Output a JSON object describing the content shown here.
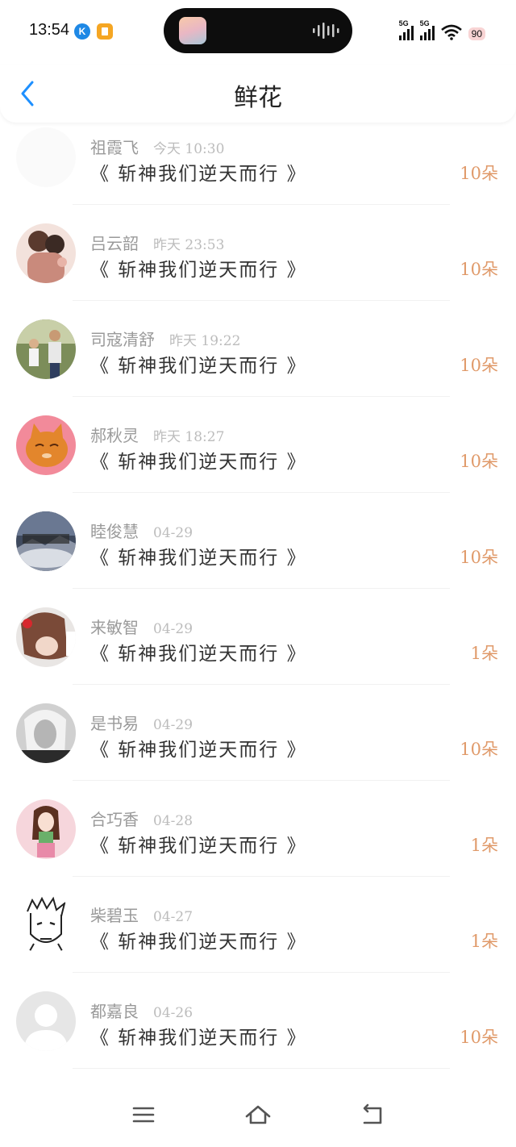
{
  "status_bar": {
    "time": "13:54",
    "badge_k": "K",
    "net1": "5G",
    "net2": "5G",
    "battery": "90"
  },
  "nav": {
    "title": "鲜花"
  },
  "items": [
    {
      "name": "祖霞飞",
      "date": "今天 10:30",
      "book": "《 斩神我们逆天而行 》",
      "count": "10朵",
      "avatar": "faded-blank"
    },
    {
      "name": "吕云韶",
      "date": "昨天 23:53",
      "book": "《 斩神我们逆天而行 》",
      "count": "10朵",
      "avatar": "anime-couple"
    },
    {
      "name": "司寇清舒",
      "date": "昨天 19:22",
      "book": "《 斩神我们逆天而行 》",
      "count": "10朵",
      "avatar": "outdoor-people"
    },
    {
      "name": "郝秋灵",
      "date": "昨天 18:27",
      "book": "《 斩神我们逆天而行 》",
      "count": "10朵",
      "avatar": "orange-cat"
    },
    {
      "name": "睦俊慧",
      "date": "04-29",
      "book": "《 斩神我们逆天而行 》",
      "count": "10朵",
      "avatar": "landscape-badge"
    },
    {
      "name": "来敏智",
      "date": "04-29",
      "book": "《 斩神我们逆天而行 》",
      "count": "1朵",
      "avatar": "girl-hair"
    },
    {
      "name": "是书易",
      "date": "04-29",
      "book": "《 斩神我们逆天而行 》",
      "count": "10朵",
      "avatar": "bw-portrait"
    },
    {
      "name": "合巧香",
      "date": "04-28",
      "book": "《 斩神我们逆天而行 》",
      "count": "1朵",
      "avatar": "doll-girl"
    },
    {
      "name": "柴碧玉",
      "date": "04-27",
      "book": "《 斩神我们逆天而行 》",
      "count": "1朵",
      "avatar": "sketch-boy"
    },
    {
      "name": "都嘉良",
      "date": "04-26",
      "book": "《 斩神我们逆天而行 》",
      "count": "10朵",
      "avatar": "default-user"
    }
  ],
  "colors": {
    "accent": "#1e90ff",
    "count": "#e09a6a"
  },
  "icons": {
    "back": "chevron-left-icon",
    "menu": "menu-icon",
    "home": "home-icon",
    "return": "return-icon"
  }
}
